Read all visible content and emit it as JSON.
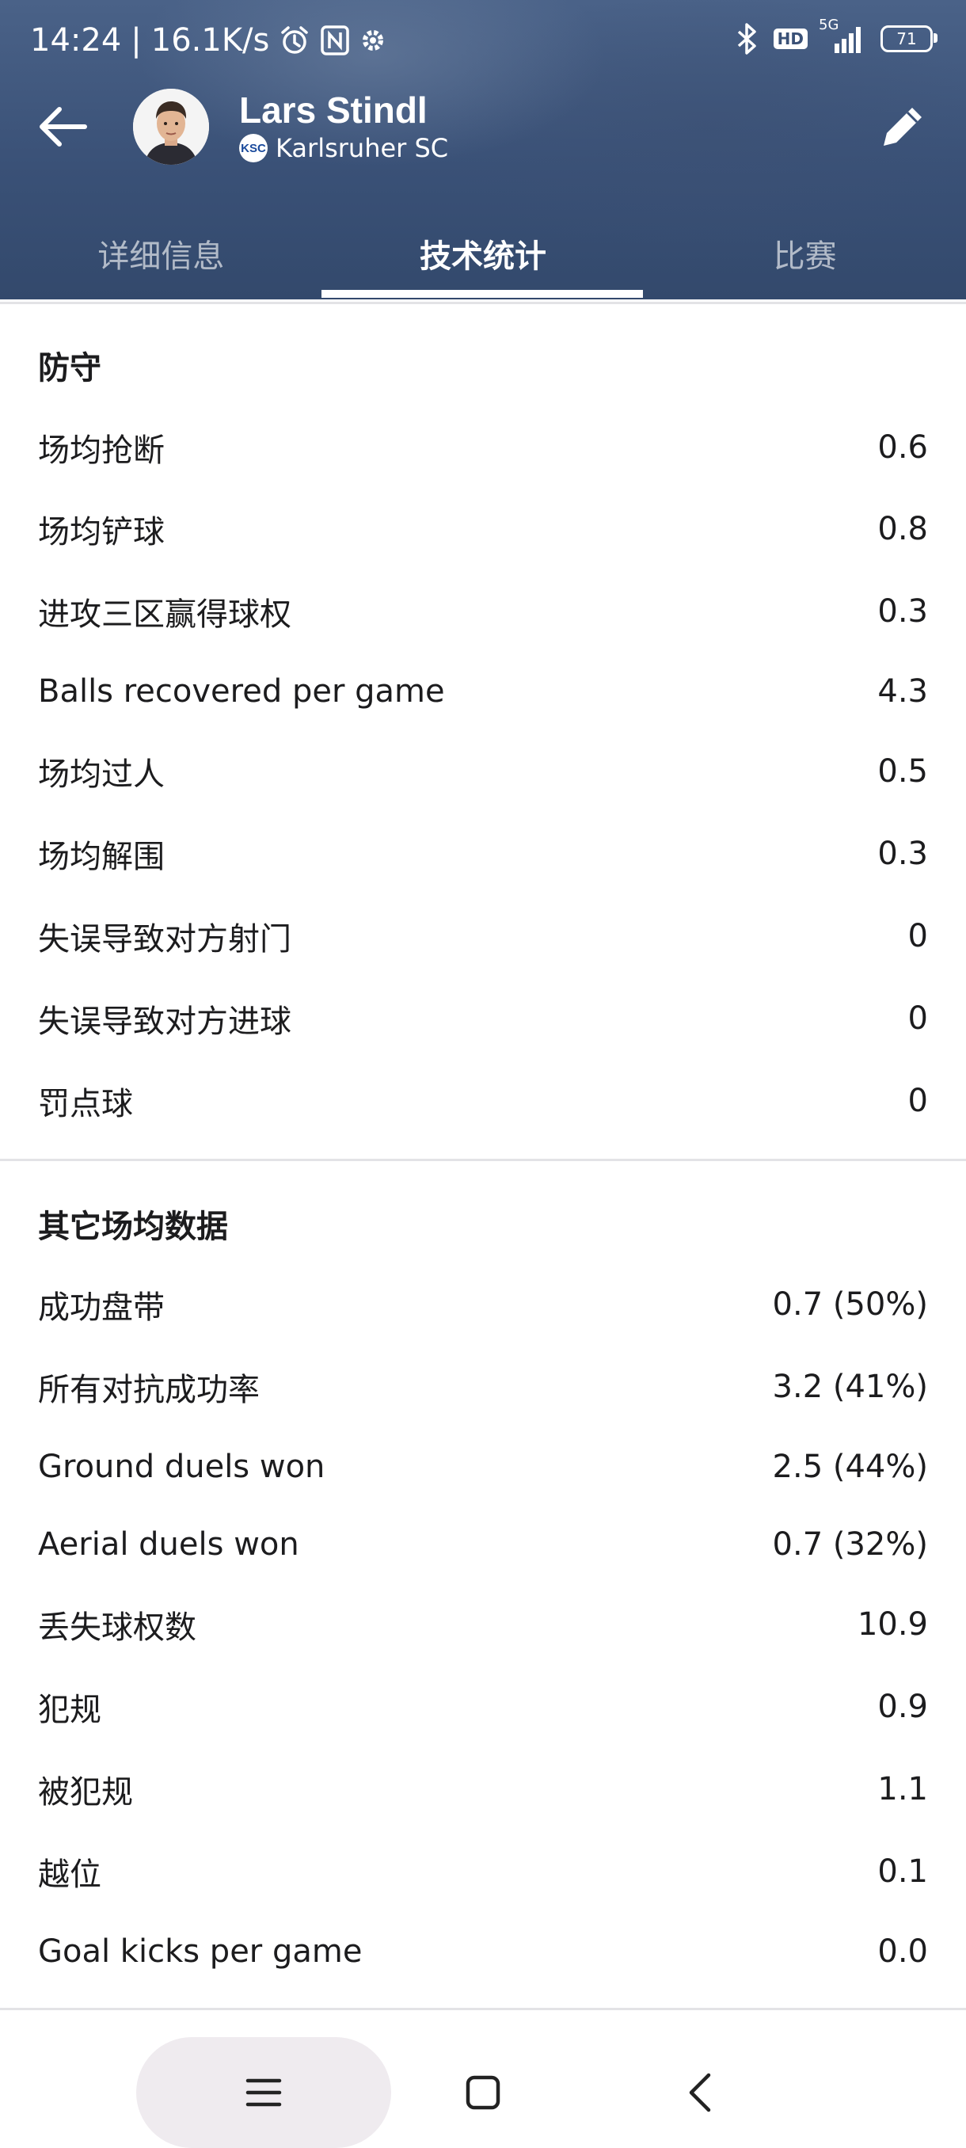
{
  "status_bar": {
    "time": "14:24",
    "separator": "|",
    "net_speed": "16.1K/s",
    "signal": "5G",
    "hd": "HD",
    "battery": "71",
    "icons": [
      "alarm-icon",
      "nfc-icon",
      "settings-icon",
      "bluetooth-icon",
      "hd-icon",
      "signal-icon",
      "battery-icon"
    ]
  },
  "header": {
    "player_name": "Lars Stindl",
    "team_name": "Karlsruher SC",
    "team_logo_text": "KSC",
    "icons": [
      "back-arrow-icon",
      "edit-pencil-icon"
    ]
  },
  "tabs": [
    {
      "label": "详细信息",
      "active": false
    },
    {
      "label": "技术统计",
      "active": true
    },
    {
      "label": "比赛",
      "active": false
    }
  ],
  "defense": {
    "title": "防守",
    "rows": [
      {
        "label": "场均抢断",
        "value": "0.6"
      },
      {
        "label": "场均铲球",
        "value": "0.8"
      },
      {
        "label": "进攻三区赢得球权",
        "value": "0.3"
      },
      {
        "label": "Balls recovered per game",
        "value": "4.3"
      },
      {
        "label": "场均过人",
        "value": "0.5"
      },
      {
        "label": "场均解围",
        "value": "0.3"
      },
      {
        "label": "失误导致对方射门",
        "value": "0"
      },
      {
        "label": "失误导致对方进球",
        "value": "0"
      },
      {
        "label": "罚点球",
        "value": "0"
      }
    ]
  },
  "other": {
    "title": "其它场均数据",
    "rows": [
      {
        "label": "成功盘带",
        "value": "0.7 (50%)"
      },
      {
        "label": "所有对抗成功率",
        "value": "3.2 (41%)"
      },
      {
        "label": "Ground duels won",
        "value": "2.5 (44%)"
      },
      {
        "label": "Aerial duels won",
        "value": "0.7 (32%)"
      },
      {
        "label": "丢失球权数",
        "value": "10.9"
      },
      {
        "label": "犯规",
        "value": "0.9"
      },
      {
        "label": "被犯规",
        "value": "1.1"
      },
      {
        "label": "越位",
        "value": "0.1"
      },
      {
        "label": "Goal kicks per game",
        "value": "0.0"
      }
    ]
  },
  "nav_bar": {
    "icons": [
      "menu-icon",
      "home-square-icon",
      "back-chevron-icon"
    ]
  },
  "colors": {
    "header_bg": "#3a5177",
    "text": "#1c1c1e",
    "divider": "#e3e3e6"
  }
}
